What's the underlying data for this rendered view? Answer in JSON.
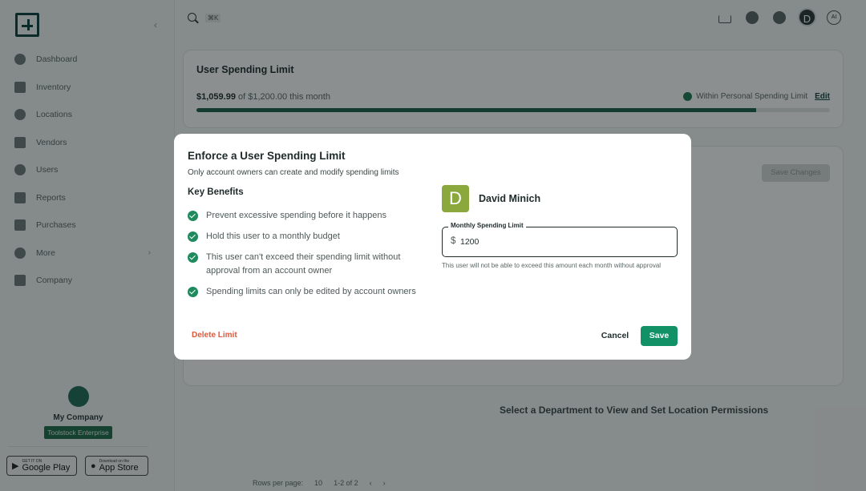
{
  "sidebar": {
    "items": [
      {
        "label": "Dashboard",
        "icon": "dashboard-icon"
      },
      {
        "label": "Inventory",
        "icon": "inventory-icon"
      },
      {
        "label": "Locations",
        "icon": "location-icon"
      },
      {
        "label": "Vendors",
        "icon": "vendor-icon"
      },
      {
        "label": "Users",
        "icon": "user-icon"
      },
      {
        "label": "Reports",
        "icon": "reports-icon"
      },
      {
        "label": "Purchases",
        "icon": "purchases-icon"
      },
      {
        "label": "More",
        "icon": "more-icon"
      },
      {
        "label": "Company",
        "icon": "company-icon"
      }
    ],
    "company_name": "My Company",
    "company_badge": "Toolstock Enterprise",
    "google_play": {
      "small": "GET IT ON",
      "big": "Google Play"
    },
    "app_store": {
      "small": "Download on the",
      "big": "App Store"
    }
  },
  "topbar": {
    "search_shortcut": "⌘K",
    "avatar_letter": "D",
    "ai_label": "AI"
  },
  "spending_card": {
    "title": "User Spending Limit",
    "amount_spent": "$1,059.99",
    "amount_suffix": "of $1,200.00 this month",
    "status": "Within Personal Spending Limit",
    "edit_label": "Edit",
    "progress_fraction": 0.883
  },
  "background": {
    "save_changes": "Save Changes",
    "department_message": "Select a Department to View and Set Location Permissions",
    "rows_per_page_label": "Rows per page:",
    "rows_per_page_value": "10",
    "page_range": "1-2 of 2"
  },
  "modal": {
    "title": "Enforce a User Spending Limit",
    "subtitle": "Only account owners can create and modify spending limits",
    "benefits_heading": "Key Benefits",
    "benefits": [
      "Prevent excessive spending before it happens",
      "Hold this user to a monthly budget",
      "This user can't exceed their spending limit without approval from an account owner",
      "Spending limits can only be edited by account owners"
    ],
    "user": {
      "initial": "D",
      "name": "David Minich",
      "avatar_color": "#8aa83c"
    },
    "limit_field": {
      "label": "Monthly Spending Limit",
      "prefix": "$",
      "value": "1200",
      "help": "This user will not be able to exceed this amount each month without approval"
    },
    "delete_label": "Delete Limit",
    "cancel_label": "Cancel",
    "save_label": "Save",
    "colors": {
      "primary": "#139166",
      "danger": "#e0583a"
    }
  }
}
